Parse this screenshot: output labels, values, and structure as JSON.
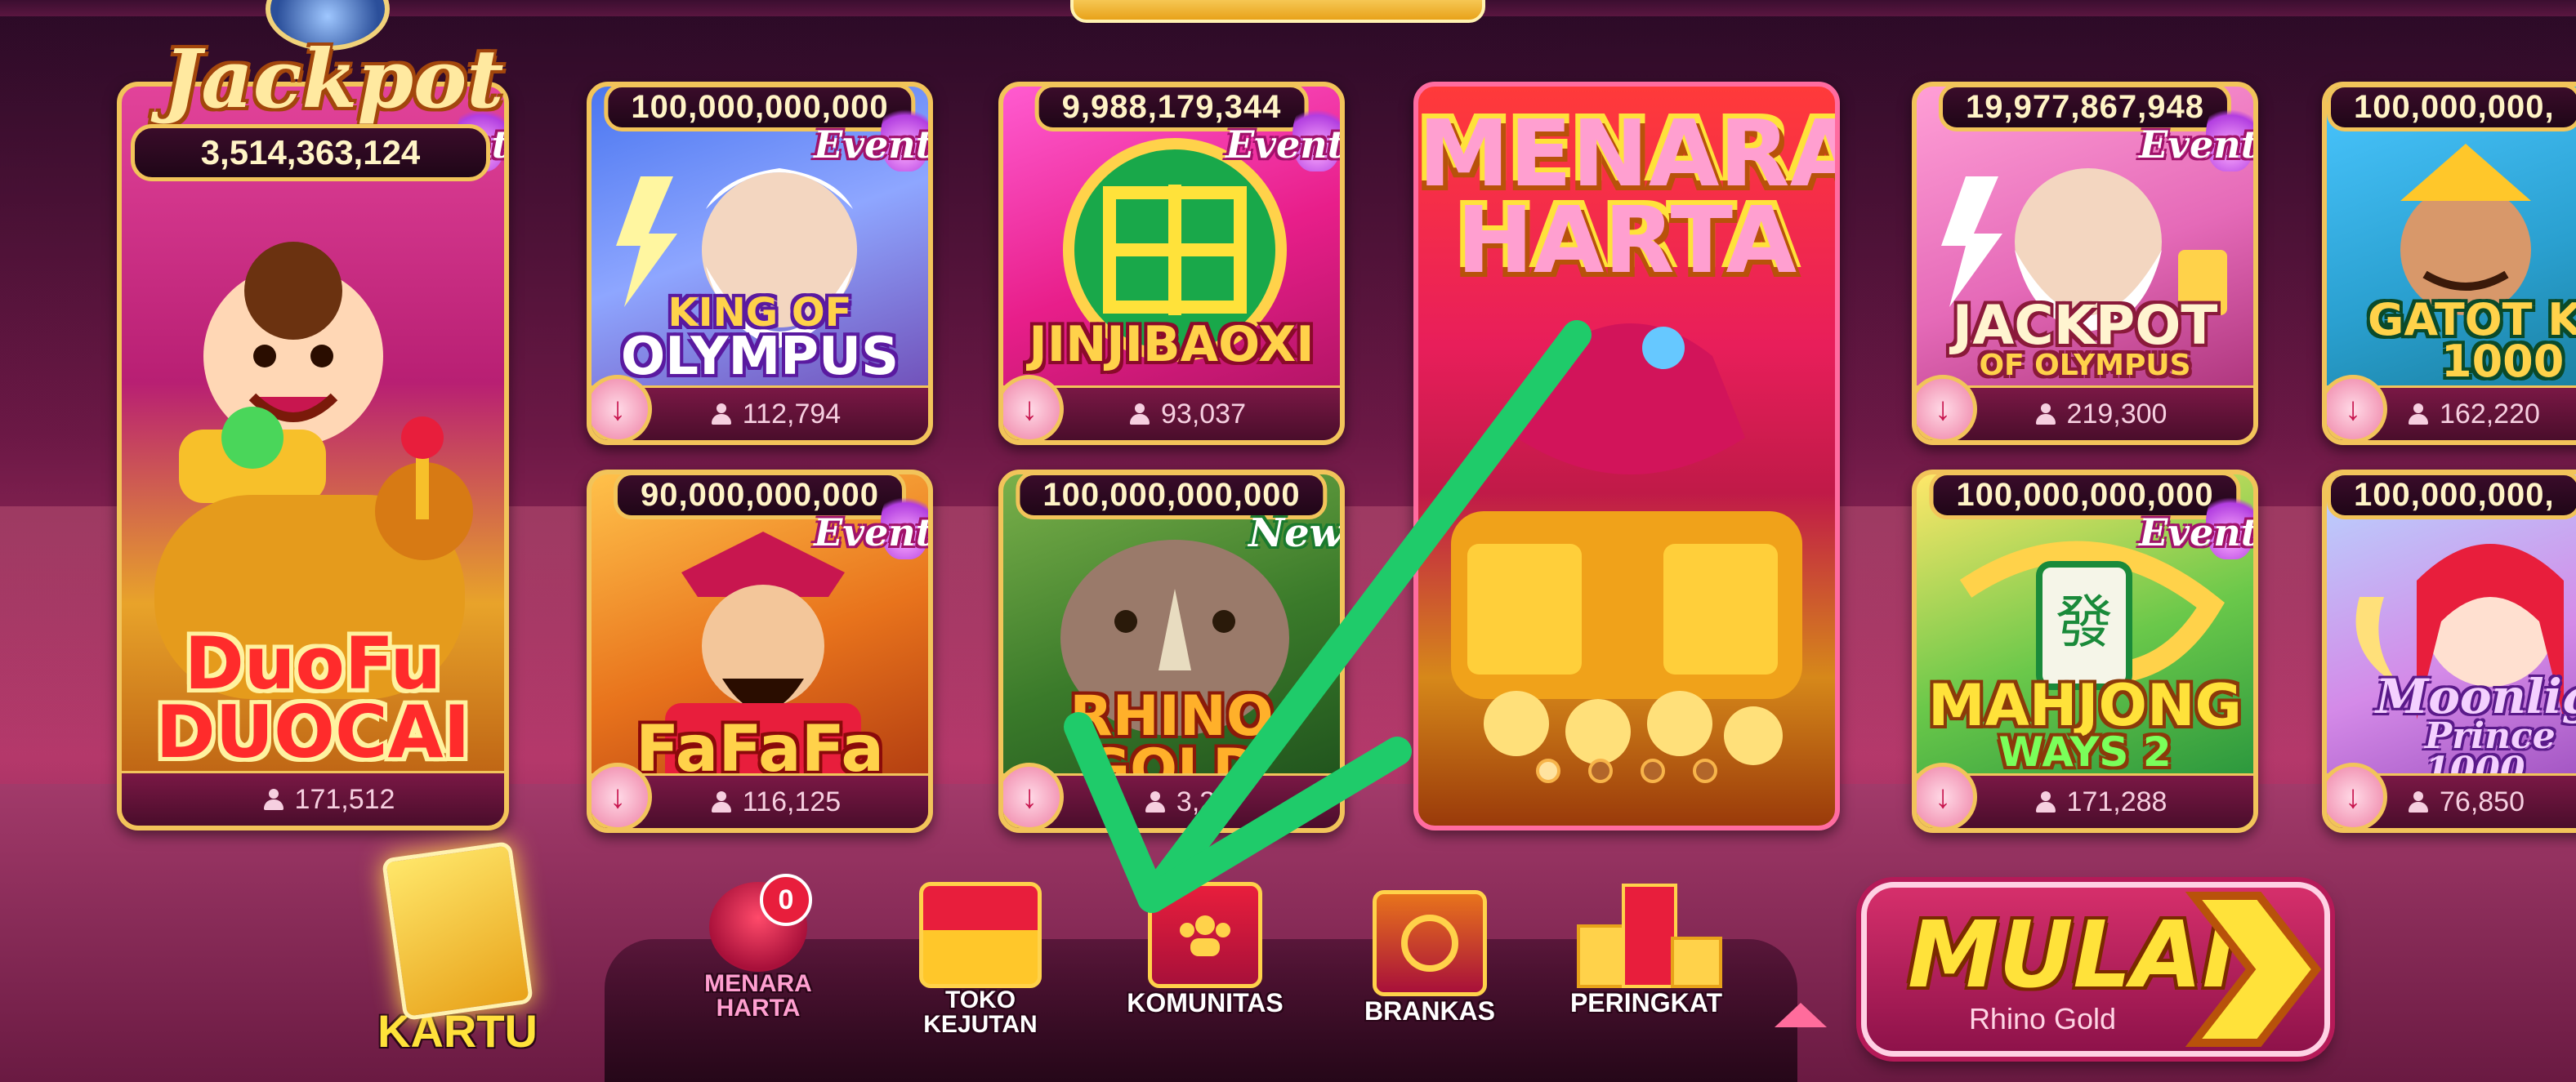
{
  "jackpot_card": {
    "title": "Jackpot",
    "amount": "3,514,363,124",
    "badge": "Event",
    "game_title_line1": "DuoFu",
    "game_title_line2": "DUOCAI",
    "players": "171,512"
  },
  "games": [
    {
      "id": "king-of-olympus",
      "jackpot": "100,000,000,000",
      "badge": "Event",
      "title_line1": "KING OF",
      "title_line2": "OLYMPUS",
      "players": "112,794"
    },
    {
      "id": "jinjibaoxi",
      "jackpot": "9,988,179,344",
      "badge": "Event",
      "title_line1": "",
      "title_line2": "JINJIBAOXI",
      "players": "93,037"
    },
    {
      "id": "jackpot-of-olympus",
      "jackpot": "19,977,867,948",
      "badge": "Event",
      "title_line1": "JACKPOT",
      "title_line2": "OF OLYMPUS",
      "players": "219,300"
    },
    {
      "id": "gatot-kaca",
      "jackpot": "100,000,000,",
      "badge": "",
      "title_line1": "GATOT KA",
      "title_line2": "1000",
      "players": "162,220"
    },
    {
      "id": "fafafa",
      "jackpot": "90,000,000,000",
      "badge": "Event",
      "title_line1": "",
      "title_line2": "FaFaFa",
      "players": "116,125"
    },
    {
      "id": "rhino-gold",
      "jackpot": "100,000,000,000",
      "badge": "New",
      "title_line1": "RHINO",
      "title_line2": "GOLD",
      "players": "3,28"
    },
    {
      "id": "mahjong-ways-2",
      "jackpot": "100,000,000,000",
      "badge": "Event",
      "title_line1": "MAHJONG",
      "title_line2": "WAYS 2",
      "players": "171,288"
    },
    {
      "id": "moonlight-princess",
      "jackpot": "100,000,000,",
      "badge": "",
      "title_line1": "Moonlig",
      "title_line2": "Prince 1000",
      "players": "76,850"
    }
  ],
  "banner": {
    "title_line1": "MENARA",
    "title_line2": "HARTA",
    "slide_count": 4,
    "active_slide": 1
  },
  "nav": {
    "kartu": "KARTU",
    "menara_harta": "MENARA HARTA",
    "menara_harta_count": "0",
    "toko_kejutan": "TOKO KEJUTAN",
    "komunitas": "KOMUNITAS",
    "brankas": "BRANKAS",
    "peringkat": "PERINGKAT"
  },
  "start_button": {
    "label": "MULAI",
    "subtitle": "Rhino Gold"
  },
  "colors": {
    "gold_border": "#f2c45a",
    "annotation_green": "#1fcb6a",
    "mulai_yellow": "#ffe23a",
    "badge_red": "#e81e3c"
  },
  "icons": [
    "download-icon",
    "person-icon",
    "chevron-right-icon",
    "chevron-up-icon",
    "dragon-icon",
    "treasure-chest-icon",
    "community-icon",
    "safe-icon",
    "podium-icon",
    "card-icon"
  ]
}
